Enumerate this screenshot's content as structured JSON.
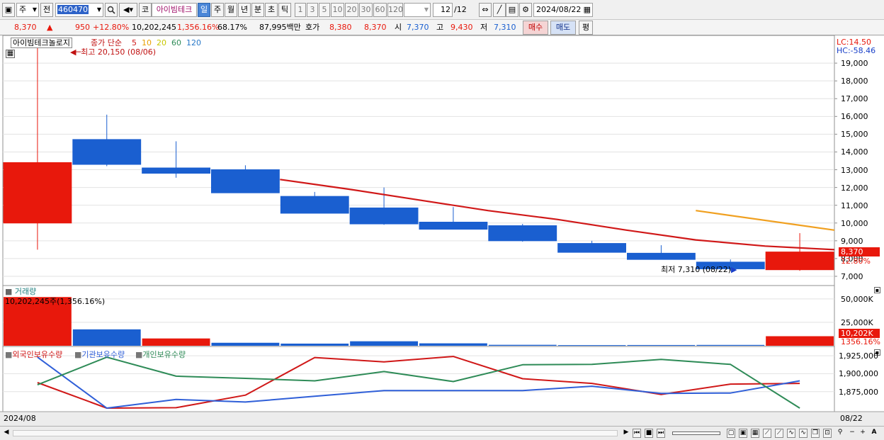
{
  "toolbar": {
    "period_week": "주",
    "view_all": "전",
    "code": "460470",
    "market_code": "코",
    "stock_name": "아이빔테크",
    "period_tabs": [
      "일",
      "주",
      "월",
      "년",
      "분",
      "초",
      "틱"
    ],
    "selected_period": "일",
    "interval_buttons": [
      "1",
      "3",
      "5",
      "10",
      "20",
      "30",
      "60",
      "120"
    ],
    "count": "12",
    "count_total": "/12",
    "date": "2024/08/22"
  },
  "quote": {
    "price": "8,370",
    "change_arrow": "▲",
    "change": "950",
    "change_pct": "+12.80%",
    "volume": "10,202,245",
    "volume_ratio": "1,356.16%",
    "turnover": "68.17%",
    "trade_value": "87,995백만",
    "bidask_label": "호가",
    "bid": "8,380",
    "ask": "8,370",
    "open_label": "시",
    "open": "7,370",
    "high_label": "고",
    "high": "9,430",
    "low_label": "저",
    "low": "7,310",
    "buy_button": "매수",
    "sell_button": "매도",
    "eval_button": "평"
  },
  "price_panel": {
    "legend_name": "아이빔테크놀로지",
    "legend_ma": "종가 단순",
    "ma_periods": [
      "5",
      "10",
      "20",
      "60",
      "120"
    ],
    "ma_colors": [
      "#d01818",
      "#e8a000",
      "#c8c800",
      "#2e8b57",
      "#2878c8"
    ],
    "max_label": "최고 20,150 (08/06)",
    "min_label": "최저 7,310 (08/22)",
    "lc_label": "LC:14.50",
    "hc_label": "HC:-58.46",
    "current_price_tag": "8,370",
    "current_pct_tag": "12.80%",
    "y_ticks": [
      "19,000",
      "18,000",
      "17,000",
      "16,000",
      "15,000",
      "14,000",
      "13,000",
      "12,000",
      "11,000",
      "10,000",
      "9,000",
      "8,000",
      "7,000"
    ]
  },
  "volume_panel": {
    "legend": "거래량",
    "info": "10,202,245주(1,356.16%)",
    "y_ticks": [
      "50,000K",
      "25,000K"
    ],
    "current_tag": "10,202K",
    "current_pct_tag": "1356.16%"
  },
  "holdings_panel": {
    "legends": [
      "외국인보유수량",
      "기관보유수량",
      "개인보유수량"
    ],
    "colors": [
      "#d01818",
      "#2f5fd8",
      "#2e8b57"
    ],
    "y_ticks": [
      "1,925,000",
      "1,900,000",
      "1,875,000"
    ]
  },
  "x_axis": {
    "start_label": "2024/08",
    "end_label": "08/22"
  },
  "colors": {
    "up": "#e8180c",
    "down": "#1a5fd0",
    "ma5": "#d01818",
    "ma10": "#f0a020"
  },
  "chart_data": [
    {
      "type": "candlestick",
      "title": "아이빔테크놀로지",
      "ylim": [
        6600,
        20400
      ],
      "candles": [
        {
          "open": 10000,
          "high": 20150,
          "low": 8500,
          "close": 13400
        },
        {
          "open": 14700,
          "high": 16100,
          "low": 13200,
          "close": 13300
        },
        {
          "open": 13100,
          "high": 14600,
          "low": 12550,
          "close": 12800
        },
        {
          "open": 13000,
          "high": 13250,
          "low": 11700,
          "close": 11700
        },
        {
          "open": 11500,
          "high": 11750,
          "low": 10550,
          "close": 10550
        },
        {
          "open": 10850,
          "high": 12000,
          "low": 9900,
          "close": 9950
        },
        {
          "open": 10050,
          "high": 10900,
          "low": 9650,
          "close": 9650
        },
        {
          "open": 9850,
          "high": 9950,
          "low": 8950,
          "close": 9000
        },
        {
          "open": 8850,
          "high": 9000,
          "low": 8350,
          "close": 8350
        },
        {
          "open": 8300,
          "high": 8750,
          "low": 7950,
          "close": 7950
        },
        {
          "open": 7800,
          "high": 7950,
          "low": 7310,
          "close": 7420
        },
        {
          "open": 7370,
          "high": 9430,
          "low": 7310,
          "close": 8370
        }
      ],
      "series": [
        {
          "name": "5",
          "values": [
            null,
            null,
            null,
            null,
            12450,
            11900,
            11300,
            10700,
            10200,
            9600,
            9050,
            8700,
            8500
          ]
        },
        {
          "name": "10",
          "values": [
            null,
            null,
            null,
            null,
            null,
            null,
            null,
            null,
            null,
            null,
            10700,
            null,
            9600
          ]
        }
      ]
    },
    {
      "type": "bar",
      "title": "거래량",
      "ylim": [
        0,
        62000
      ],
      "values": [
        52000,
        17500,
        7800,
        3200,
        2300,
        4800,
        2600,
        1000,
        700,
        800,
        900,
        10202
      ],
      "up": [
        true,
        false,
        true,
        false,
        false,
        false,
        false,
        false,
        false,
        false,
        false,
        true
      ]
    },
    {
      "type": "line",
      "ylim": [
        1848000,
        1935000
      ],
      "series": [
        {
          "name": "외국인보유수량",
          "values": [
            1887500,
            1852000,
            1852500,
            1870000,
            1922500,
            1916500,
            1924000,
            1893000,
            1886500,
            1871000,
            1885500,
            1886500
          ]
        },
        {
          "name": "기관보유수량",
          "values": [
            1923000,
            1852000,
            1864000,
            1860500,
            1868500,
            1876500,
            1876500,
            1876500,
            1882500,
            1872500,
            1873000,
            1890000
          ]
        },
        {
          "name": "개인보유수량",
          "values": [
            1884500,
            1923000,
            1896500,
            1893500,
            1890000,
            1903000,
            1889000,
            1912500,
            1913000,
            1920000,
            1913000,
            1852000
          ]
        }
      ]
    }
  ]
}
